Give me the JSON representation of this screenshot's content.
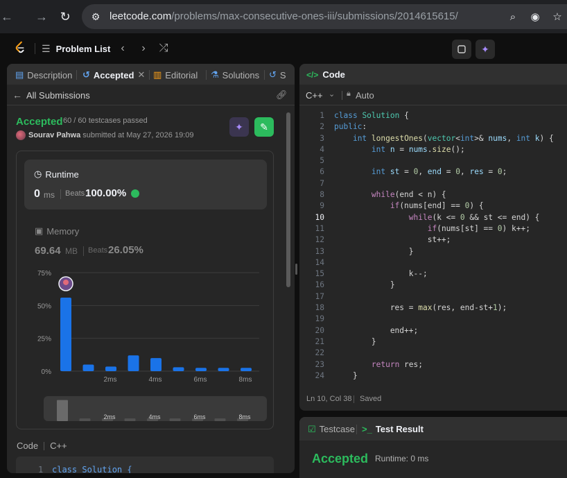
{
  "browser": {
    "url_host": "leetcode.com",
    "url_path": "/problems/max-consecutive-ones-iii/submissions/2014615615/"
  },
  "nav": {
    "problem_list_label": "Problem List"
  },
  "left_tabs": [
    {
      "label": "Description"
    },
    {
      "label": "Accepted"
    },
    {
      "label": "Editorial"
    },
    {
      "label": "Solutions"
    },
    {
      "label": "S"
    }
  ],
  "submission": {
    "back_label": "All Submissions",
    "status": "Accepted",
    "testcases": "60 / 60 testcases passed",
    "user": "Sourav Pahwa",
    "submitted_at": "submitted at May 27, 2026 19:09"
  },
  "runtime": {
    "label": "Runtime",
    "value": "0",
    "unit": "ms",
    "beats_label": "Beats",
    "beats": "100.00%"
  },
  "memory": {
    "label": "Memory",
    "value": "69.64",
    "unit": "MB",
    "beats_label": "Beats",
    "beats": "26.05%"
  },
  "chart_data": {
    "type": "bar",
    "y_ticks": [
      "75%",
      "50%",
      "25%",
      "0%"
    ],
    "ylim": [
      0,
      75
    ],
    "x_ticks": [
      "2ms",
      "4ms",
      "6ms",
      "8ms"
    ],
    "values": [
      56,
      5,
      3.5,
      12,
      10,
      3,
      2.5,
      2.5,
      2.5
    ],
    "highlight_index": 0,
    "bar_color": "#1a73e8",
    "mini_values": [
      95,
      12,
      12,
      12,
      12,
      12,
      12,
      12,
      12
    ],
    "mini_ticks": [
      "2ms",
      "4ms",
      "6ms",
      "8ms"
    ]
  },
  "code_section": {
    "label": "Code",
    "language": "C++",
    "preview_line": "class Solution {"
  },
  "editor": {
    "title": "Code",
    "language": "C++",
    "mode": "Auto",
    "cursor": "Ln 10, Col 38",
    "status": "Saved",
    "current_line": 10
  },
  "result": {
    "tab_testcase": "Testcase",
    "tab_result": "Test Result",
    "status": "Accepted",
    "runtime": "Runtime: 0 ms"
  }
}
